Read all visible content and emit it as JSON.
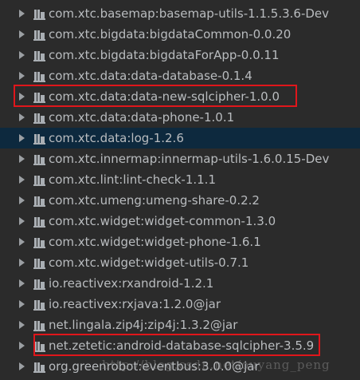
{
  "tree": {
    "items": [
      {
        "label": "com.xtc.basemap:basemap-utils-1.1.5.3.6-Dev"
      },
      {
        "label": "com.xtc.bigdata:bigdataCommon-0.0.20"
      },
      {
        "label": "com.xtc.bigdata:bigdataForApp-0.0.11"
      },
      {
        "label": "com.xtc.data:data-database-0.1.4"
      },
      {
        "label": "com.xtc.data:data-new-sqlcipher-1.0.0"
      },
      {
        "label": "com.xtc.data:data-phone-1.0.1"
      },
      {
        "label": "com.xtc.data:log-1.2.6"
      },
      {
        "label": "com.xtc.innermap:innermap-utils-1.6.0.15-Dev"
      },
      {
        "label": "com.xtc.lint:lint-check-1.1.1"
      },
      {
        "label": "com.xtc.umeng:umeng-share-0.2.2"
      },
      {
        "label": "com.xtc.widget:widget-common-1.3.0"
      },
      {
        "label": "com.xtc.widget:widget-phone-1.6.1"
      },
      {
        "label": "com.xtc.widget:widget-utils-0.7.1"
      },
      {
        "label": "io.reactivex:rxandroid-1.2.1"
      },
      {
        "label": "io.reactivex:rxjava:1.2.0@jar"
      },
      {
        "label": "net.lingala.zip4j:zip4j:1.3.2@jar"
      },
      {
        "label": "net.zetetic:android-database-sqlcipher-3.5.9"
      },
      {
        "label": "org.greenrobot:eventbus:3.0.0@jar"
      }
    ],
    "selected_index": 6,
    "highlighted_indices": [
      4,
      16
    ]
  },
  "colors": {
    "background": "#2b2b2b",
    "selected_row": "#0d293e",
    "highlight_box": "#e0161b",
    "text": "#b9bcbf"
  },
  "icons": {
    "expand": "triangle-right-icon",
    "library": "library-icon"
  },
  "watermark": "http://blog.csdn.net/ouyang_peng"
}
